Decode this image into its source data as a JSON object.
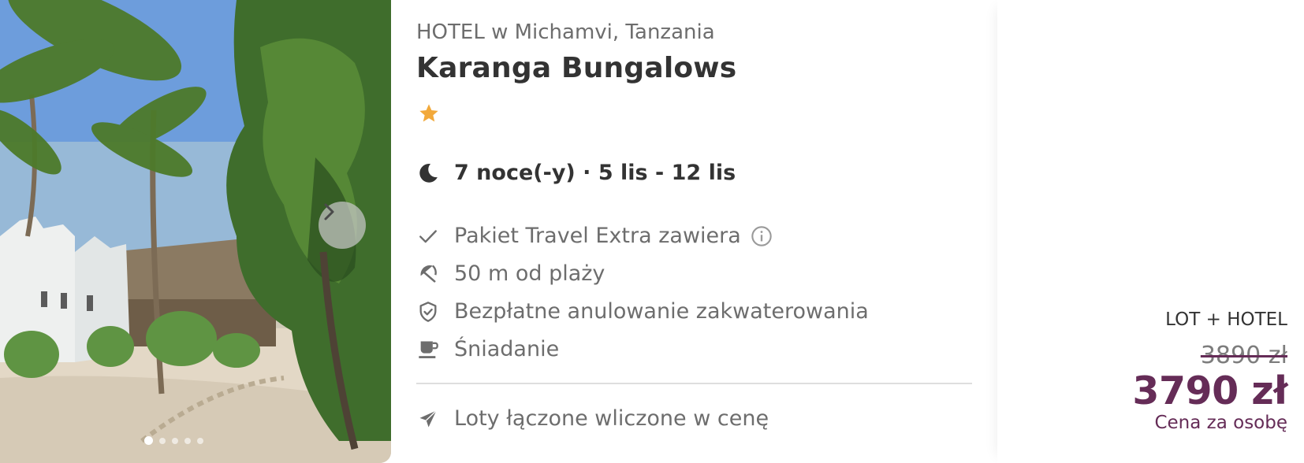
{
  "hotel": {
    "location": "HOTEL w Michamvi, Tanzania",
    "name": "Karanga Bungalows",
    "stars": 1,
    "star_color": "#f2a93b"
  },
  "gallery": {
    "slide_count": 5,
    "active_slide": 1,
    "next_icon": "chevron-right-icon"
  },
  "stay": {
    "icon": "moon-icon",
    "text": "7 noce(-y) · 5 lis - 12 lis"
  },
  "features": [
    {
      "icon": "checkmark-icon",
      "label": "Pakiet Travel Extra zawiera",
      "has_info": true
    },
    {
      "icon": "beach-umbrella-icon",
      "label": "50 m od plaży"
    },
    {
      "icon": "shield-check-icon",
      "label": "Bezpłatne anulowanie zakwaterowania"
    },
    {
      "icon": "coffee-cup-icon",
      "label": "Śniadanie"
    }
  ],
  "flight": {
    "icon": "airplane-icon",
    "label": "Loty łączone wliczone w cenę"
  },
  "price": {
    "package_type": "LOT + HOTEL",
    "old_price": "3890 zł",
    "new_price": "3790 zł",
    "per_person": "Cena za osobę",
    "accent_color": "#652c57"
  }
}
